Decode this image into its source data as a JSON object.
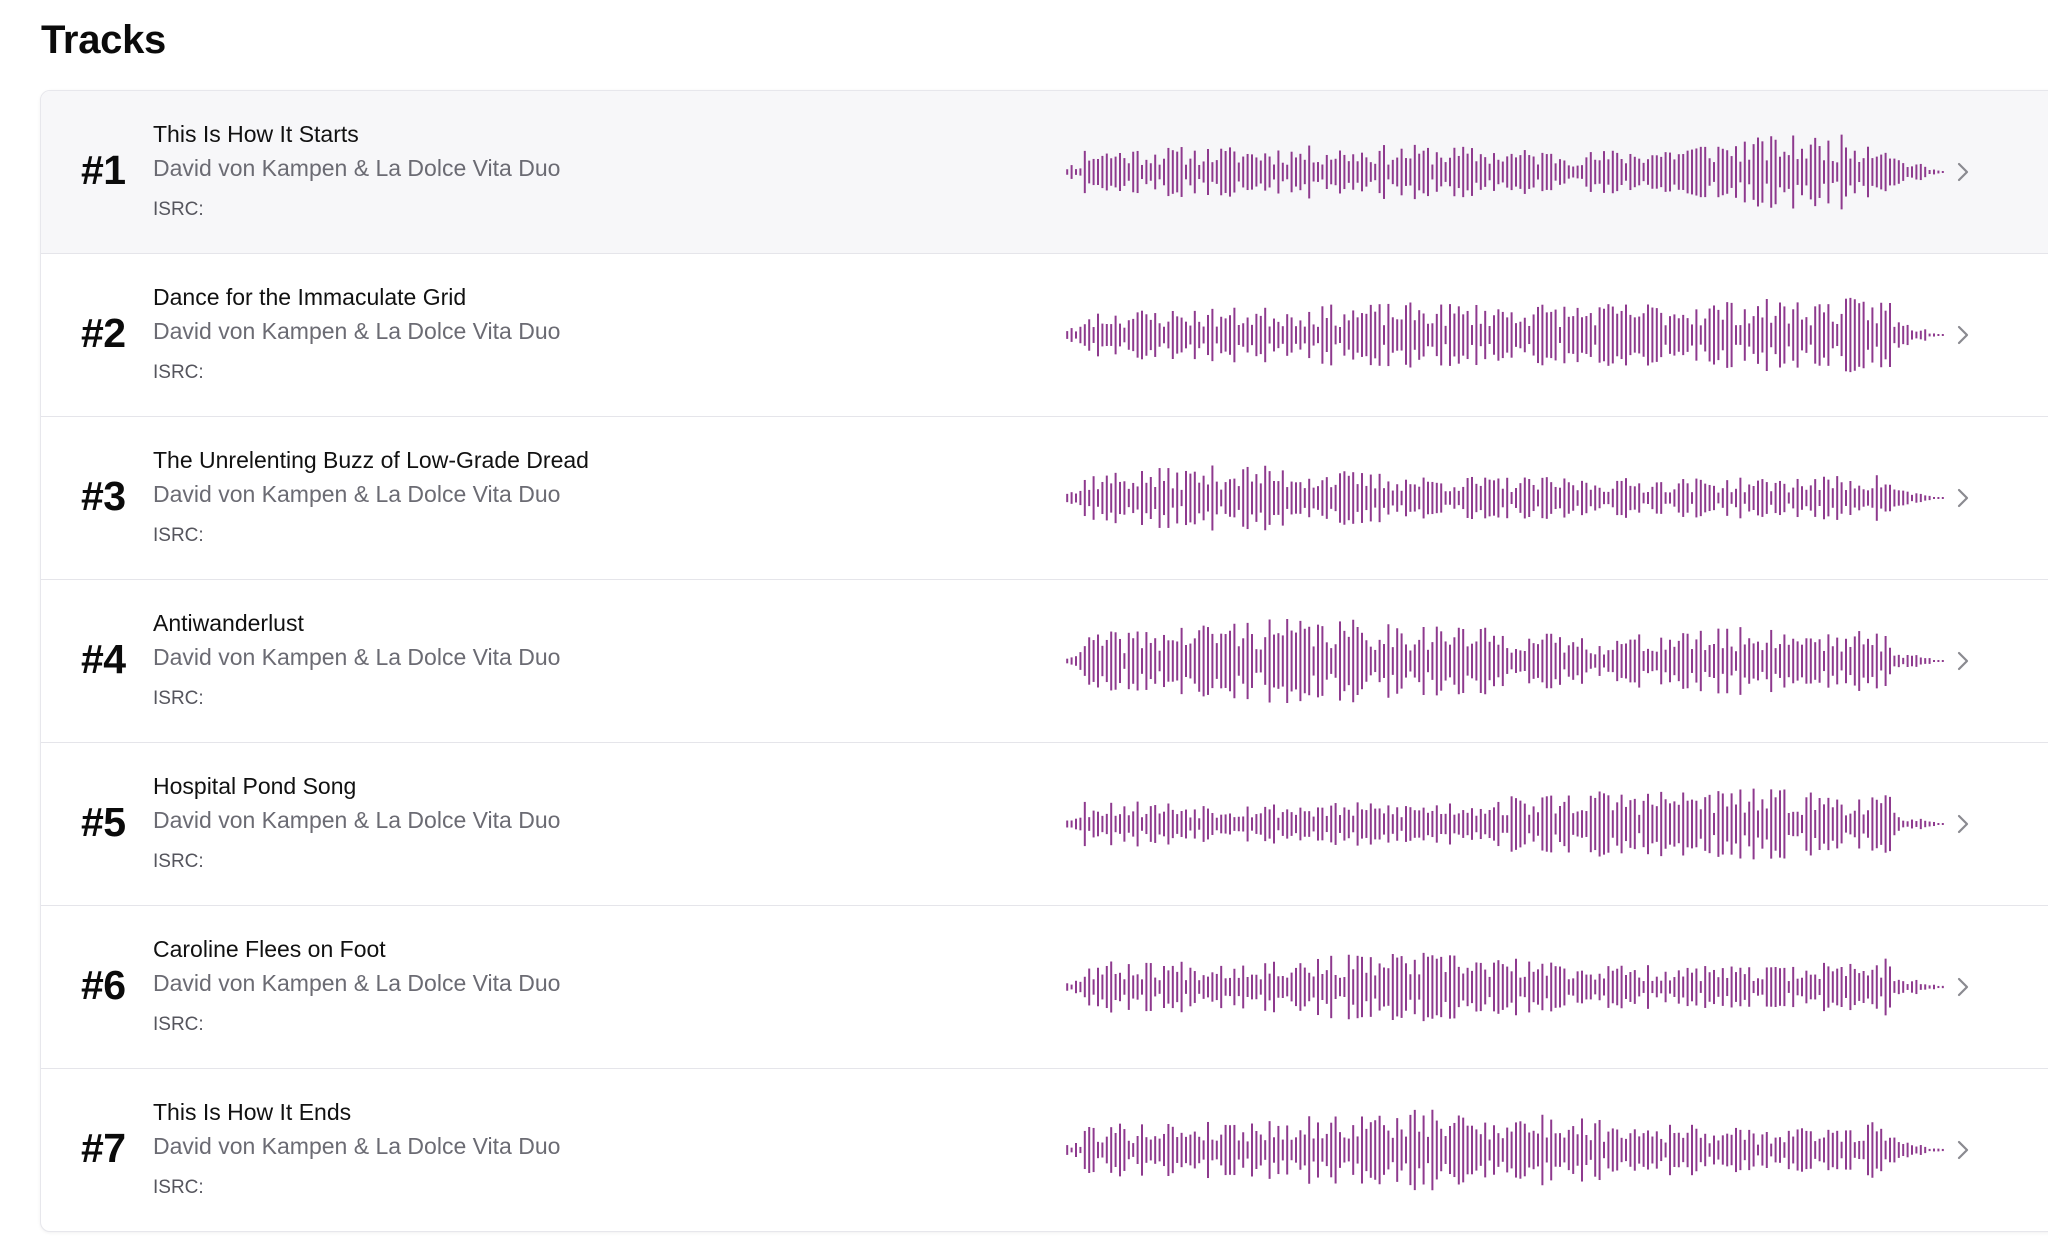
{
  "page": {
    "title": "Tracks"
  },
  "accent_color": "#8e3a8e",
  "tracks": [
    {
      "number": "#1",
      "title": "This Is How It Starts",
      "artist": "David von Kampen & La Dolce Vita Duo",
      "isrc_label": "ISRC:",
      "active": true,
      "seed": 11
    },
    {
      "number": "#2",
      "title": "Dance for the Immaculate Grid",
      "artist": "David von Kampen & La Dolce Vita Duo",
      "isrc_label": "ISRC:",
      "active": false,
      "seed": 23
    },
    {
      "number": "#3",
      "title": "The Unrelenting Buzz of Low-Grade Dread",
      "artist": "David von Kampen & La Dolce Vita Duo",
      "isrc_label": "ISRC:",
      "active": false,
      "seed": 37
    },
    {
      "number": "#4",
      "title": "Antiwanderlust",
      "artist": "David von Kampen & La Dolce Vita Duo",
      "isrc_label": "ISRC:",
      "active": false,
      "seed": 41
    },
    {
      "number": "#5",
      "title": "Hospital Pond Song",
      "artist": "David von Kampen & La Dolce Vita Duo",
      "isrc_label": "ISRC:",
      "active": false,
      "seed": 53
    },
    {
      "number": "#6",
      "title": "Caroline Flees on Foot",
      "artist": "David von Kampen & La Dolce Vita Duo",
      "isrc_label": "ISRC:",
      "active": false,
      "seed": 67
    },
    {
      "number": "#7",
      "title": "This Is How It Ends",
      "artist": "David von Kampen & La Dolce Vita Duo",
      "isrc_label": "ISRC:",
      "active": false,
      "seed": 79
    }
  ],
  "icons": {
    "row_action": "chevron-right-icon"
  }
}
